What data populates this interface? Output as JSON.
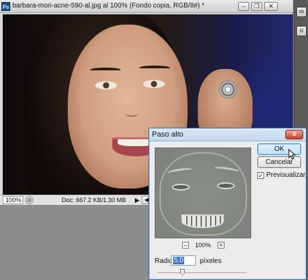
{
  "document": {
    "app_badge": "Ps",
    "title": "barbara-mori-acne-590-al.jpg al 100% (Fondo copia, RGB/8#) *",
    "window_buttons": [
      "–",
      "❐",
      "✕"
    ]
  },
  "statusbar": {
    "zoom": "100%",
    "doc_size": "Doc: 667.2 KB/1.30 MB",
    "arrow": "▶",
    "nav_icon": "◎",
    "scroll_arrow": "◀"
  },
  "dock": {
    "icons": [
      "vb",
      "⊟"
    ]
  },
  "dialog": {
    "title": "Paso alto",
    "close": "x",
    "ok": "OK",
    "cancel": "Cancelar",
    "preview_checked": "✓",
    "preview_label": "Previsualizar",
    "zoom_minus": "–",
    "zoom_plus": "+",
    "zoom_level": "100%",
    "radius_label": "Radio:",
    "radius_value": "5,0",
    "radius_unit": "píxeles",
    "radius_slider_fraction": 0.28
  },
  "colors": {
    "dialog_border": "#3d6fa6",
    "ok_accent": "#3b86c9",
    "close_red": "#c7402c"
  }
}
